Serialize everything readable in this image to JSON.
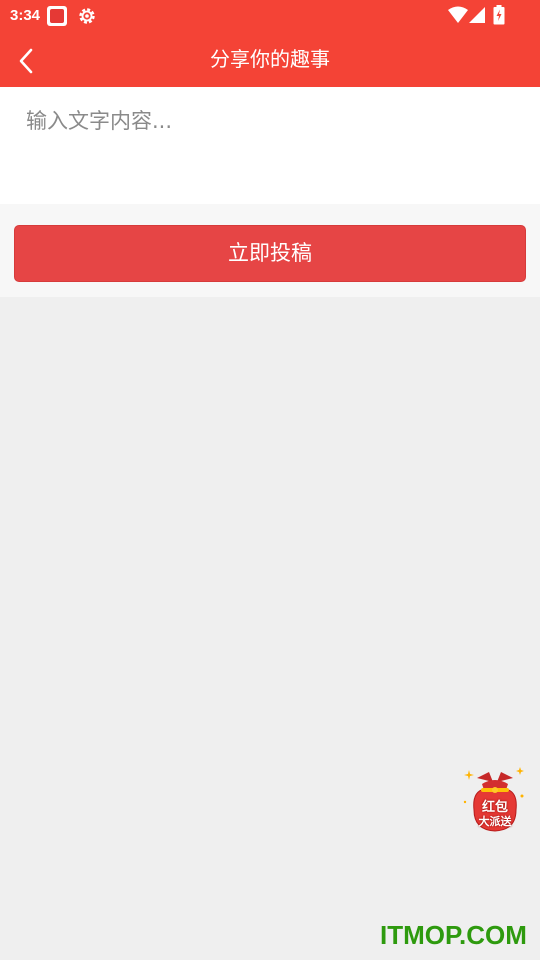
{
  "status_bar": {
    "time": "3:34",
    "icons": [
      "app-notification-icon",
      "settings-gear-icon",
      "wifi-icon",
      "cell-signal-icon",
      "battery-charging-icon"
    ]
  },
  "app_bar": {
    "title": "分享你的趣事",
    "back_icon": "chevron-left-icon"
  },
  "content": {
    "placeholder": "输入文字内容...",
    "value": ""
  },
  "submit": {
    "label": "立即投稿"
  },
  "floating_badge": {
    "line1": "红包",
    "line2": "大派送"
  },
  "watermark": {
    "text": "ITMOP.COM"
  },
  "colors": {
    "primary": "#f44336",
    "button": "#e64545",
    "background": "#efefef",
    "watermark": "#2e9a0e"
  }
}
